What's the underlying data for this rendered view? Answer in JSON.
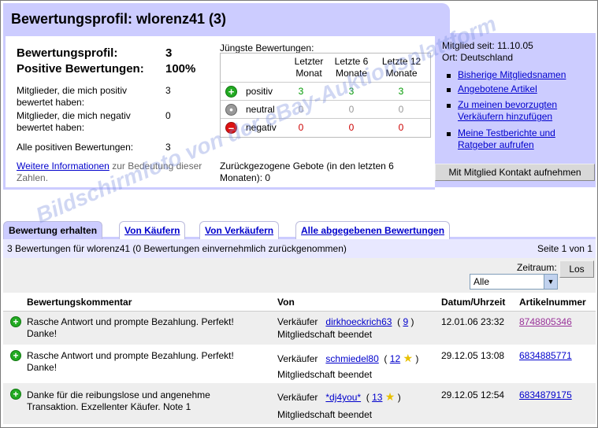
{
  "header": {
    "title": "Bewertungsprofil: wlorenz41 (3)"
  },
  "summary": {
    "profile_label": "Bewertungsprofil:",
    "profile_value": "3",
    "positive_label": "Positive Bewertungen:",
    "positive_value": "100%",
    "members_pos_label": "Mitglieder, die mich positiv bewertet haben:",
    "members_pos_value": "3",
    "members_neg_label": "Mitglieder, die mich negativ bewertet haben:",
    "members_neg_value": "0",
    "all_pos_label": "Alle positiven Bewertungen:",
    "all_pos_value": "3",
    "more_info_link": "Weitere Informationen",
    "more_info_rest": "zur Bedeutung dieser Zahlen."
  },
  "recent": {
    "title": "Jüngste Bewertungen:",
    "columns": [
      "Letzter Monat",
      "Letzte 6 Monate",
      "Letzte 12 Monate"
    ],
    "rows": [
      {
        "label": "positiv",
        "values": [
          "3",
          "3",
          "3"
        ]
      },
      {
        "label": "neutral",
        "values": [
          "0",
          "0",
          "0"
        ]
      },
      {
        "label": "negativ",
        "values": [
          "0",
          "0",
          "0"
        ]
      }
    ],
    "withdrawn": "Zurückgezogene Gebote (in den letzten 6 Monaten): 0"
  },
  "member": {
    "since": "Mitglied seit: 11.10.05",
    "location": "Ort: Deutschland",
    "links": [
      "Bisherige Mitgliedsnamen",
      "Angebotene Artikel",
      "Zu meinen bevorzugten Verkäufern hinzufügen",
      "Meine Testberichte und Ratgeber aufrufen"
    ],
    "contact_button": "Mit Mitglied Kontakt aufnehmen"
  },
  "tabs": [
    "Bewertung erhalten",
    "Von Käufern",
    "Von Verkäufern",
    "Alle abgegebenen Bewertungen"
  ],
  "list": {
    "count_text": "3 Bewertungen für wlorenz41 (0 Bewertungen einvernehmlich zurückgenommen)",
    "page_text": "Seite 1 von 1",
    "period_label": "Zeitraum:",
    "period_value": "Alle",
    "go_button": "Los",
    "columns": [
      "Bewertungskommentar",
      "Von",
      "Datum/Uhrzeit",
      "Artikelnummer"
    ],
    "rows": [
      {
        "comment": "Rasche Antwort und prompte Bezahlung. Perfekt! Danke!",
        "role": "Verkäufer",
        "user": "dirkhoeckrich63",
        "score": "9",
        "star": false,
        "status": "Mitgliedschaft beendet",
        "date": "12.01.06 23:32",
        "item": "8748805346"
      },
      {
        "comment": "Rasche Antwort und prompte Bezahlung. Perfekt! Danke!",
        "role": "Verkäufer",
        "user": "schmiedel80",
        "score": "12",
        "star": true,
        "status": "Mitgliedschaft beendet",
        "date": "29.12.05 13:08",
        "item": "6834885771"
      },
      {
        "comment": "Danke für die reibungslose und angenehme Transaktion. Exzellenter Käufer. Note 1",
        "role": "Verkäufer",
        "user": "*dj4you*",
        "score": "13",
        "star": true,
        "status": "Mitgliedschaft beendet",
        "date": "29.12.05 12:54",
        "item": "6834879175"
      }
    ]
  },
  "watermark": "Bildschirmfoto von der eBay-Auktionsplattform",
  "colors": {
    "band": "#ccccff",
    "link": "#0000cc",
    "positive": "#009900",
    "negative": "#cc0000"
  },
  "icons": {
    "positive": "plus-circle-icon",
    "neutral": "dot-circle-icon",
    "negative": "minus-circle-icon",
    "star": "yellow-star-icon"
  }
}
